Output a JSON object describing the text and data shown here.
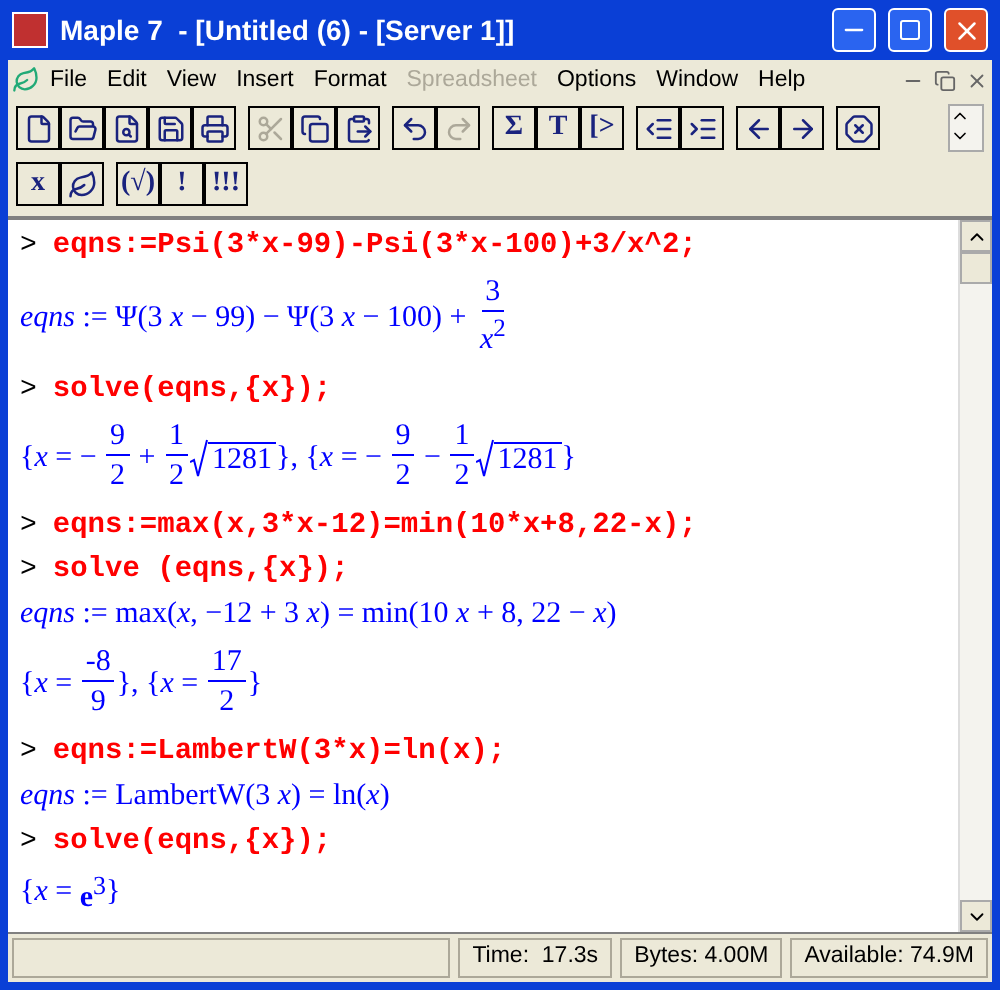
{
  "window": {
    "title": "Maple 7  - [Untitled (6) - [Server 1]]"
  },
  "menu": [
    {
      "label": "File",
      "disabled": false
    },
    {
      "label": "Edit",
      "disabled": false
    },
    {
      "label": "View",
      "disabled": false
    },
    {
      "label": "Insert",
      "disabled": false
    },
    {
      "label": "Format",
      "disabled": false
    },
    {
      "label": "Spreadsheet",
      "disabled": true
    },
    {
      "label": "Options",
      "disabled": false
    },
    {
      "label": "Window",
      "disabled": false
    },
    {
      "label": "Help",
      "disabled": false
    }
  ],
  "toolbars": [
    [
      [
        {
          "kind": "icon",
          "disabled": false
        },
        {
          "kind": "icon",
          "disabled": false
        },
        {
          "kind": "icon",
          "disabled": false
        },
        {
          "kind": "icon",
          "disabled": false
        },
        {
          "kind": "icon",
          "disabled": false
        }
      ],
      [
        {
          "kind": "icon",
          "disabled": true
        },
        {
          "kind": "icon",
          "disabled": false
        },
        {
          "kind": "icon",
          "disabled": false
        }
      ],
      [
        {
          "kind": "icon",
          "disabled": false
        },
        {
          "kind": "icon",
          "disabled": true
        }
      ],
      [
        {
          "kind": "glyph",
          "label": "Σ",
          "disabled": false
        },
        {
          "kind": "glyph",
          "label": "T",
          "disabled": false
        },
        {
          "kind": "glyph",
          "label": "[>",
          "disabled": false
        }
      ],
      [
        {
          "kind": "icon",
          "disabled": false
        },
        {
          "kind": "icon",
          "disabled": false
        }
      ],
      [
        {
          "kind": "icon",
          "disabled": false
        },
        {
          "kind": "icon",
          "disabled": false
        }
      ],
      [
        {
          "kind": "icon",
          "disabled": false
        }
      ]
    ],
    [
      [
        {
          "kind": "glyph",
          "label": "x",
          "disabled": false
        },
        {
          "kind": "icon",
          "disabled": false
        }
      ],
      [
        {
          "kind": "glyph",
          "label": "(√)",
          "disabled": false
        },
        {
          "kind": "glyph",
          "label": "!",
          "disabled": false
        },
        {
          "kind": "glyph",
          "label": "!!!",
          "disabled": false
        }
      ]
    ]
  ],
  "worksheet": [
    {
      "kind": "input",
      "prompt": ">",
      "text": "eqns:=Psi(3*x-99)-Psi(3*x-100)+3/x^2;"
    },
    {
      "kind": "output",
      "parts": [
        {
          "kind": "text",
          "text": "*eqns* := Ψ(3 *x* − 99) − Ψ(3 *x* − 100) + "
        },
        {
          "kind": "frac",
          "num": "3",
          "den": "*x*$^{2}$"
        }
      ]
    },
    {
      "kind": "input",
      "prompt": ">",
      "text": "solve(eqns,{x});"
    },
    {
      "kind": "output",
      "parts": [
        {
          "kind": "text",
          "text": "{*x* = − "
        },
        {
          "kind": "frac",
          "num": "9",
          "den": "2"
        },
        {
          "kind": "text",
          "text": " + "
        },
        {
          "kind": "frac",
          "num": "1",
          "den": "2"
        },
        {
          "kind": "sqrt",
          "radicand": "1281"
        },
        {
          "kind": "text",
          "text": "}, {*x* = − "
        },
        {
          "kind": "frac",
          "num": "9",
          "den": "2"
        },
        {
          "kind": "text",
          "text": " − "
        },
        {
          "kind": "frac",
          "num": "1",
          "den": "2"
        },
        {
          "kind": "sqrt",
          "radicand": "1281"
        },
        {
          "kind": "text",
          "text": "}"
        }
      ]
    },
    {
      "kind": "input",
      "prompt": ">",
      "text": "eqns:=max(x,3*x-12)=min(10*x+8,22-x);"
    },
    {
      "kind": "input",
      "prompt": ">",
      "text": "solve (eqns,{x});"
    },
    {
      "kind": "output",
      "parts": [
        {
          "kind": "text",
          "text": "*eqns* := max(*x*, −12 + 3 *x*) = min(10 *x* + 8, 22 − *x*)"
        }
      ]
    },
    {
      "kind": "output",
      "parts": [
        {
          "kind": "text",
          "text": "{*x* = "
        },
        {
          "kind": "frac",
          "num": "-8",
          "den": "9"
        },
        {
          "kind": "text",
          "text": "}, {*x* = "
        },
        {
          "kind": "frac",
          "num": "17",
          "den": "2"
        },
        {
          "kind": "text",
          "text": "}"
        }
      ]
    },
    {
      "kind": "input",
      "prompt": ">",
      "text": "eqns:=LambertW(3*x)=ln(x);"
    },
    {
      "kind": "output",
      "parts": [
        {
          "kind": "text",
          "text": "*eqns* := LambertW(3 *x*) = ln(*x*)"
        }
      ]
    },
    {
      "kind": "input",
      "prompt": ">",
      "text": "solve(eqns,{x});"
    },
    {
      "kind": "output",
      "parts": [
        {
          "kind": "text",
          "text": "{*x* = "
        },
        {
          "kind": "power",
          "base": "**e**",
          "exp": "3"
        },
        {
          "kind": "text",
          "text": "}"
        }
      ]
    }
  ],
  "status_bar": [
    {
      "text": "Time:  17.3s"
    },
    {
      "text": "Bytes: 4.00M"
    },
    {
      "text": "Available: 74.9M"
    }
  ]
}
